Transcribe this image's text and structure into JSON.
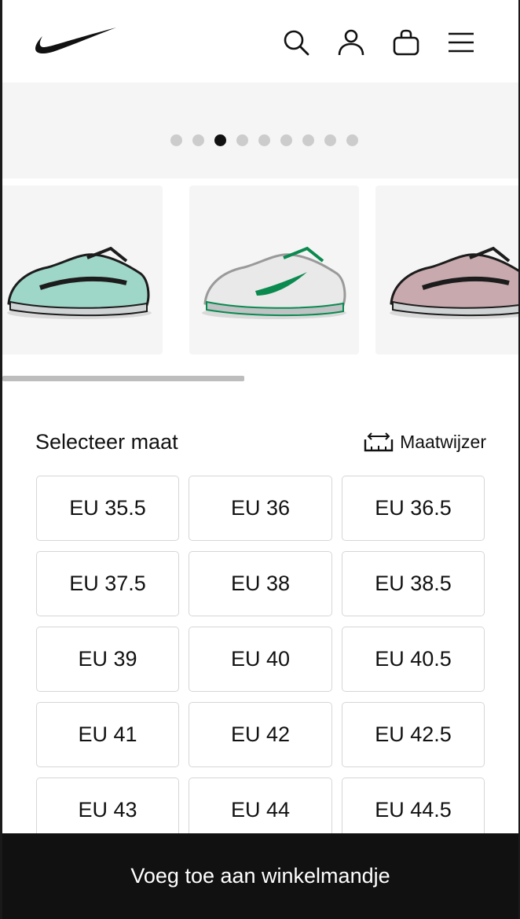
{
  "header": {
    "icons": [
      "nike-swoosh-logo",
      "search-icon",
      "account-icon",
      "bag-icon",
      "menu-icon"
    ]
  },
  "gallery": {
    "dot_count": 9,
    "active_dot": 3
  },
  "thumbnails": [
    {
      "name": "shoe-mint-silver",
      "colors": [
        "#9ed6c8",
        "#1c1c1c",
        "#cfd3d4"
      ]
    },
    {
      "name": "shoe-white-green",
      "colors": [
        "#e9e9e9",
        "#0a8a4f",
        "#bfc3c4"
      ]
    },
    {
      "name": "shoe-mauve-silver",
      "colors": [
        "#c8a9ae",
        "#1c1c1c",
        "#cfd3d4"
      ]
    }
  ],
  "sizes": {
    "title": "Selecteer maat",
    "guide_label": "Maatwijzer",
    "options": [
      "EU 35.5",
      "EU 36",
      "EU 36.5",
      "EU 37.5",
      "EU 38",
      "EU 38.5",
      "EU 39",
      "EU 40",
      "EU 40.5",
      "EU 41",
      "EU 42",
      "EU 42.5",
      "EU 43",
      "EU 44",
      "EU 44.5"
    ]
  },
  "cta": {
    "label": "Voeg toe aan winkelmandje"
  },
  "colors": {
    "accent": "#111111",
    "gallery_bg": "#f5f5f5",
    "dot_inactive": "#cccccc",
    "border": "#d6d6d6"
  }
}
